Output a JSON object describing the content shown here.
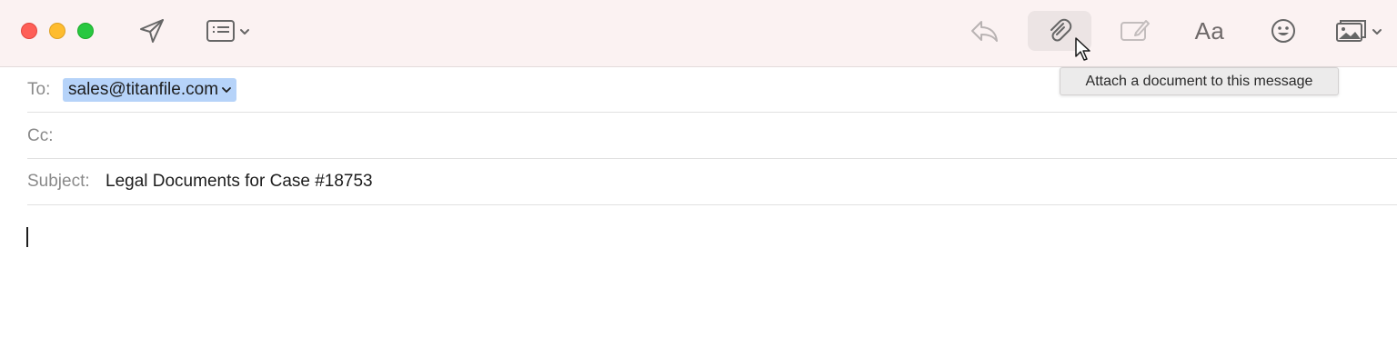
{
  "toolbar": {
    "font_button_label": "Aa",
    "tooltip": "Attach a document to this message"
  },
  "icons": {
    "send": "paper-plane-icon",
    "header_fields": "header-fields-icon",
    "reply": "reply-arrow-icon",
    "attach": "paperclip-icon",
    "markup": "markup-icon",
    "font": "font-icon",
    "emoji": "smiley-icon",
    "photo": "photo-browser-icon"
  },
  "compose": {
    "to_label": "To:",
    "to_recipient": "sales@titanfile.com",
    "cc_label": "Cc:",
    "subject_label": "Subject:",
    "subject_value": "Legal Documents for Case #18753"
  },
  "colors": {
    "toolbar_bg": "#fbf2f2",
    "token_bg": "#b6d3f9",
    "close": "#fe5f57",
    "minimize": "#febc2e",
    "zoom": "#28c840"
  }
}
